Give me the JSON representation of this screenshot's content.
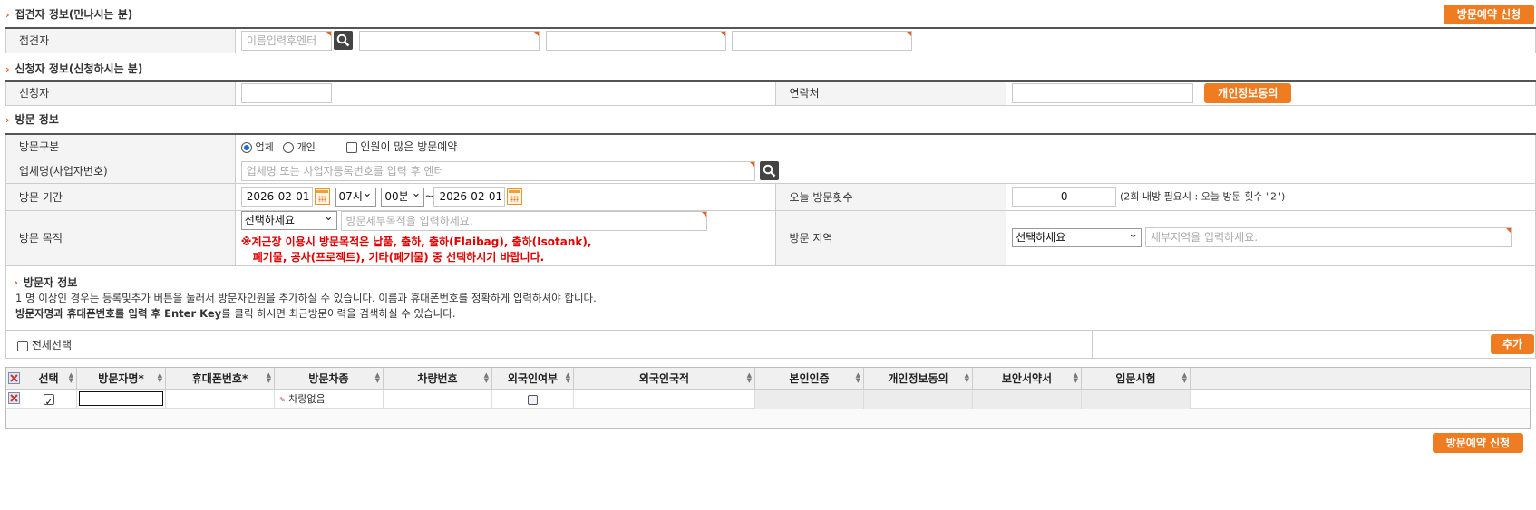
{
  "host_section": {
    "title": "접견자 정보(만나시는 분)",
    "submit_label": "방문예약 신청",
    "host_label": "접견자",
    "host_name_placeholder": "이름입력후엔터"
  },
  "applicant_section": {
    "title": "신청자 정보(신청하시는 분)",
    "applicant_label": "신청자",
    "contact_label": "연락처",
    "privacy_button": "개인정보동의"
  },
  "visit_section": {
    "title": "방문 정보",
    "type_label": "방문구분",
    "type_company": "업체",
    "type_personal": "개인",
    "many_people_label": "인원이 많은 방문예약",
    "company_label": "업체명(사업자번호)",
    "company_placeholder": "업체명 또는 사업자등록번호를 입력 후 엔터",
    "period_label": "방문 기간",
    "start_date": "2026-02-01",
    "start_hour": "07시",
    "start_min": "00분",
    "tilde": "~",
    "end_date": "2026-02-01",
    "today_count_label": "오늘 방문횟수",
    "today_count_value": "0",
    "today_count_note": "(2회 내방 필요시 : 오늘 방문 횟수 \"2\")",
    "purpose_label": "방문 목적",
    "purpose_select": "선택하세요",
    "purpose_detail_placeholder": "방문세부목적을 입력하세요.",
    "purpose_notice_1": "※계근장 이용시 방문목적은 납품, 출하, 출하(Flaibag), 출하(Isotank),",
    "purpose_notice_2": "폐기물, 공사(프로젝트), 기타(폐기물) 중 선택하시기 바랍니다.",
    "area_label": "방문 지역",
    "area_select": "선택하세요",
    "area_detail_placeholder": "세부지역을 입력하세요."
  },
  "visitor_info": {
    "title": "방문자 정보",
    "line1": "1 명 이상인 경우는 등록및추가 버튼을 눌러서 방문자인원을 추가하실 수 있습니다. 이름과 휴대폰번호를 정확하게 입력하셔야 합니다.",
    "line2_bold": "방문자명과 휴대폰번호를 입력 후 Enter Key",
    "line2_rest": "를 클릭 하시면 최근방문이력을 검색하실 수 있습니다.",
    "select_all": "전체선택",
    "add_button": "추가"
  },
  "grid": {
    "columns": [
      "선택",
      "방문자명*",
      "휴대폰번호*",
      "방문차종",
      "차량번호",
      "외국인여부",
      "외국인국적",
      "본인인증",
      "개인정보동의",
      "보안서약서",
      "입문시험"
    ],
    "row": {
      "vehicle_type": "차량없음"
    }
  },
  "bottom": {
    "submit_label": "방문예약 신청"
  },
  "colors": {
    "accent": "#f07c22",
    "notice_red": "#e00000"
  }
}
